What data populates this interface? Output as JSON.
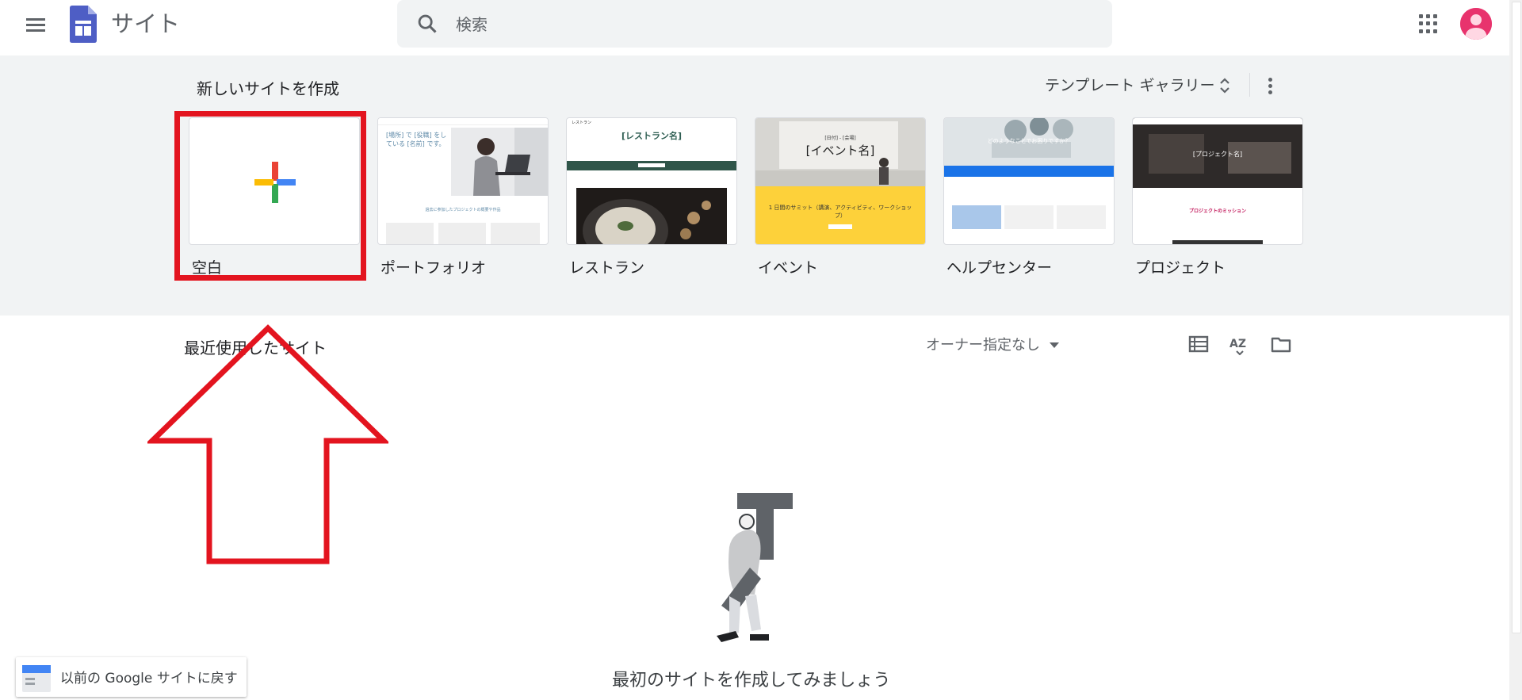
{
  "app": {
    "title": "サイト"
  },
  "search": {
    "placeholder": "検索"
  },
  "templates": {
    "section_title": "新しいサイトを作成",
    "gallery_label": "テンプレート ギャラリー",
    "items": [
      {
        "label": "空白"
      },
      {
        "label": "ポートフォリオ",
        "thumb_heading": "[場所] で [役職] をしている [名前] です。",
        "thumb_text": "過去に参加したプロジェクトの概要や作品"
      },
      {
        "label": "レストラン",
        "thumb_brand": "レストラン",
        "thumb_heading": "[レストラン名]"
      },
      {
        "label": "イベント",
        "thumb_heading": "[イベント名]",
        "thumb_date": "[日付] - [会場]",
        "thumb_text": "1 日間のサミット（講演、アクティビティ、ワークショップ）"
      },
      {
        "label": "ヘルプセンター",
        "thumb_heading": "どのようなことでお困りですか？"
      },
      {
        "label": "プロジェクト",
        "thumb_heading": "[プロジェクト名]",
        "thumb_text": "プロジェクトのミッション"
      }
    ]
  },
  "recent": {
    "title": "最近使用したサイト",
    "owner_filter": "オーナー指定なし",
    "empty_message": "最初のサイトを作成してみましょう"
  },
  "classic_sites": {
    "label": "以前の Google サイトに戻す"
  },
  "icons": {
    "menu": "menu-icon",
    "logo": "google-sites-logo",
    "search": "search-icon",
    "gallery_expand": "unfold-more-icon",
    "more": "more-vert-icon",
    "apps": "apps-grid-icon",
    "account": "account-avatar",
    "list_view": "list-view-icon",
    "sort": "sort-az-icon",
    "folder": "folder-icon"
  },
  "colors": {
    "annotation_red": "#e3141f",
    "header_gray": "#5f6368",
    "section_bg": "#f1f3f4",
    "sites_purple": "#3f51b5",
    "avatar_pink": "#e8336d"
  }
}
